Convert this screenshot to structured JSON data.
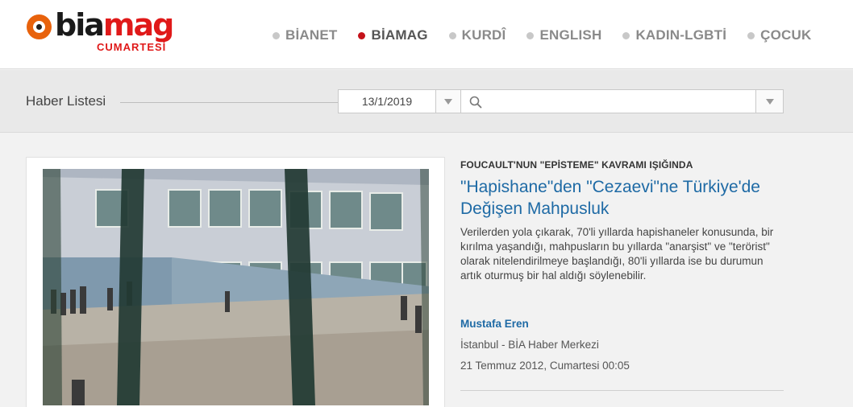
{
  "header": {
    "logo": {
      "main": "biamag",
      "sub": "CUMARTESİ"
    },
    "nav": [
      {
        "label": "BİANET",
        "active": false
      },
      {
        "label": "BİAMAG",
        "active": true
      },
      {
        "label": "KURDÎ",
        "active": false
      },
      {
        "label": "ENGLISH",
        "active": false
      },
      {
        "label": "KADIN-LGBTİ",
        "active": false
      },
      {
        "label": "ÇOCUK",
        "active": false
      }
    ]
  },
  "filter": {
    "title": "Haber Listesi",
    "date_value": "13/1/2019",
    "search_value": "",
    "search_placeholder": ""
  },
  "article": {
    "kicker": "FOUCAULT'NUN \"EPİSTEME\" KAVRAMI IŞIĞINDA",
    "headline": "\"Hapishane\"den \"Cezaevi\"ne Türkiye'de Değişen Mahpusluk",
    "summary": "Verilerden yola çıkarak, 70'li yıllarda hapishaneler konusunda, bir kırılma yaşandığı, mahpusların bu yıllarda \"anarşist\" ve \"terörist\" olarak nitelendirilmeye başlandığı, 80'li yıllarda ise bu durumun artık oturmuş bir hal aldığı söylenebilir.",
    "author": "Mustafa Eren",
    "source": "İstanbul - BİA Haber Merkezi",
    "date": "21 Temmuz 2012, Cumartesi 00:05"
  },
  "colors": {
    "brand_red": "#e01919",
    "logo_orange": "#e8620c",
    "link_blue": "#1e6aa5",
    "nav_active_dot": "#c4121a"
  }
}
